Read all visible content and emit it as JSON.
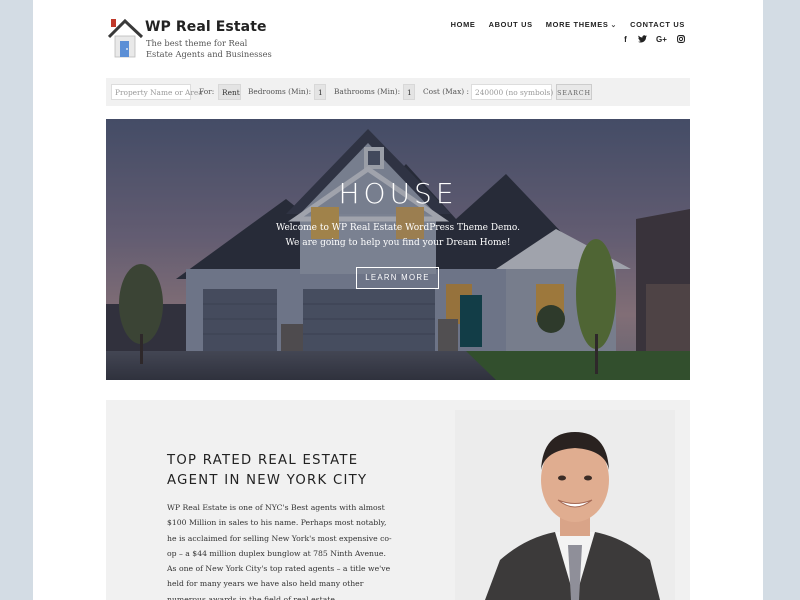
{
  "header": {
    "logo_title": "WP Real Estate",
    "logo_tagline": "The best theme for Real Estate Agents and Businesses",
    "nav": [
      "HOME",
      "ABOUT US",
      "MORE THEMES",
      "CONTACT US"
    ],
    "social_icons": [
      "facebook-icon",
      "twitter-icon",
      "google-plus-icon",
      "instagram-icon"
    ]
  },
  "search": {
    "property_placeholder": "Property Name or Area",
    "for_label": "For:",
    "for_value": "Rent",
    "bedrooms_label": "Bedrooms (Min):",
    "bedrooms_value": "1",
    "bathrooms_label": "Bathrooms (Min):",
    "bathrooms_value": "1",
    "cost_label": "Cost (Max) :",
    "cost_placeholder": "240000 (no symbols)",
    "search_button": "SEARCH"
  },
  "hero": {
    "title": "HOUSE",
    "subtitle_line1": "Welcome to WP Real Estate WordPress Theme Demo.",
    "subtitle_line2": "We are going to help you find your Dream Home!",
    "button": "LEARN MORE"
  },
  "about": {
    "heading": "TOP RATED REAL ESTATE AGENT IN NEW YORK CITY",
    "body": "WP Real Estate is one of NYC's Best agents with almost $100 Million in sales to his name. Perhaps most notably, he is acclaimed for selling New York's most expensive co-op – a $44 million duplex bunglow at 785 Ninth Avenue. As one of New York City's top rated agents – a title we've held for many years we have also held many other numerous awards in the field of real estate."
  },
  "colors": {
    "page_bg": "#d3dce4",
    "panel_bg": "#f1f1f1",
    "logo_roof": "#3a3a3a",
    "logo_chimney": "#c0392b",
    "logo_door": "#5b8fd6"
  }
}
